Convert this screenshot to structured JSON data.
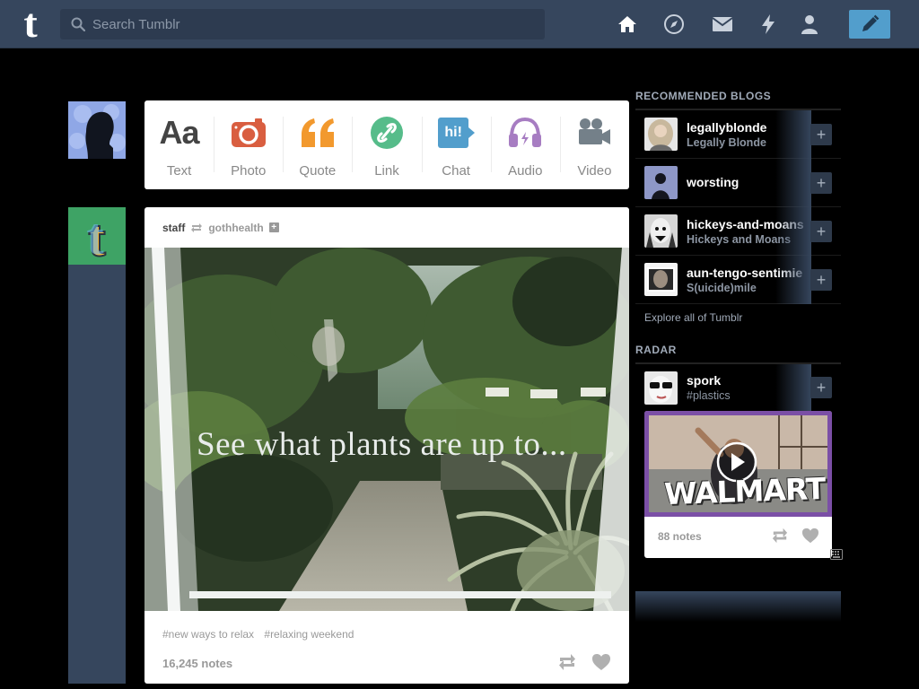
{
  "header": {
    "search_placeholder": "Search Tumblr",
    "nav": [
      "home-icon",
      "explore-icon",
      "messages-icon",
      "activity-icon",
      "account-icon"
    ],
    "compose": "pencil-icon",
    "colors": {
      "bar": "#36465d",
      "compose": "#529ecc"
    }
  },
  "post_types": [
    {
      "label": "Text",
      "glyph": "Aa",
      "color": "#444444"
    },
    {
      "label": "Photo",
      "color": "#d95e40"
    },
    {
      "label": "Quote",
      "glyph": "“",
      "color": "#f2992e"
    },
    {
      "label": "Link",
      "color": "#56bc8a"
    },
    {
      "label": "Chat",
      "glyph": "hi!",
      "color": "#529ecc"
    },
    {
      "label": "Audio",
      "color": "#a77dc2"
    },
    {
      "label": "Video",
      "color": "#748089"
    }
  ],
  "post": {
    "author": "staff",
    "reblogged_from": "gothhealth",
    "photo_caption": "See what plants are up to...",
    "tags": [
      "#new ways to relax",
      "#relaxing weekend"
    ],
    "notes": "16,245 notes"
  },
  "sidebar": {
    "recommended_title": "RECOMMENDED BLOGS",
    "blogs": [
      {
        "name": "legallyblonde",
        "title": "Legally Blonde"
      },
      {
        "name": "worsting",
        "title": ""
      },
      {
        "name": "hickeys-and-moans",
        "title": "Hickeys and Moans"
      },
      {
        "name": "aun-tengo-sentimie",
        "title": "S(uicide)mile"
      }
    ],
    "explore": "Explore all of Tumblr",
    "radar_title": "RADAR",
    "radar": {
      "name": "spork",
      "title": "#plastics",
      "image_text": "WALMART",
      "notes": "88 notes"
    }
  }
}
